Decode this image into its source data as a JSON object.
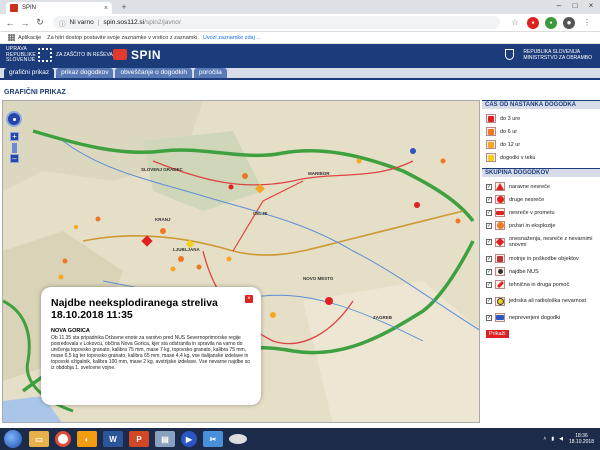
{
  "browser": {
    "tab_title": "SPIN",
    "url_info": "Ni varno",
    "url_host": "spin.sos112.si",
    "url_path": "/spin2/javno/",
    "bookmarks_label": "Aplikacije",
    "bookmarks_hint": "Za hitri dostop postavite svoje zaznamke v vrstico z zaznamki.",
    "bookmarks_link": "Uvozi zaznamke zdaj ..."
  },
  "site": {
    "org_line1": "UPRAVA",
    "org_line2": "REPUBLIKE",
    "org_line3": "SLOVENIJE",
    "org_line4": "ZA ZAŠČITO IN REŠEVANJE",
    "brand": "SPIN",
    "ministry_line1": "REPUBLIKA SLOVENIJA",
    "ministry_line2": "MINISTRSTVO ZA OBRAMBO"
  },
  "nav": {
    "tabs": [
      "grafični prikaz",
      "prikaz dogodkov",
      "obveščanje o dogodkih",
      "poročila"
    ]
  },
  "page": {
    "title": "GRAFIČNI PRIKAZ"
  },
  "map": {
    "places": [
      "MARIBOR",
      "SLOVENJ GRADEC",
      "CELJE",
      "KRANJ",
      "LJUBLJANA",
      "NOVO MESTO",
      "ZAGREB"
    ]
  },
  "popup": {
    "title_line1": "Najdbe neeksplodiranega streliva",
    "title_line2": "18.10.2018 11:35",
    "place": "NOVA GORICA",
    "body": "Ob 11.35 sta pripadnika Državne enote za varstvo pred NUS Severnoprimorske regije posredovala v Lokovcu, občina Nova Gorica, kjer sta odstranila in spravila na varno do uničenja topovsko granato, kalibra 75 mm, mase 7 kg, topovsko granato, kalibra 75 mm, mase 6,5 kg ter topovsko granato, kalibra 65 mm, mase 4,4 kg, vse italijanske izdelave in topovski vžigalnik, kalibra 100 mm, mase 2 kg, avstrijske izdelave. Vse nevarne najdbe so iz obdobja 1. svetovne vojne."
  },
  "panel": {
    "time_heading": "ČAS OD NASTANKA DOGODKA",
    "time_items": [
      {
        "label": "do 3 ure",
        "color": "#e02020"
      },
      {
        "label": "do 6 ur",
        "color": "#f07820"
      },
      {
        "label": "do 12 ur",
        "color": "#f5a623"
      },
      {
        "label": "dogodki v teku",
        "color": "#f0d020"
      }
    ],
    "group_heading": "SKUPINA DOGODKOV",
    "group_items": [
      {
        "label": "naravne nesreče",
        "icon": "triangle-icon"
      },
      {
        "label": "druge nesreče",
        "icon": "circle-icon"
      },
      {
        "label": "nesreče v prometu",
        "icon": "car-icon"
      },
      {
        "label": "požari in eksplozije",
        "icon": "fire-icon"
      },
      {
        "label": "onesnaženja, nesreče z nevarnimi snovmi",
        "icon": "diamond-icon"
      },
      {
        "label": "motnje in poškodbe objektov",
        "icon": "building-icon"
      },
      {
        "label": "najdbe NUS",
        "icon": "bomb-icon"
      },
      {
        "label": "tehnična in druga pomoč",
        "icon": "wrench-icon"
      },
      {
        "label": "jedrska ali radiološka nevarnost",
        "icon": "radiation-icon"
      },
      {
        "label": "nepreverjeni dogodki",
        "icon": "unknown-icon"
      }
    ],
    "show_button": "Prikaži"
  },
  "taskbar": {
    "time": "18:36",
    "date": "18.10.2018"
  },
  "colors": {
    "header_blue": "#1b3b7a",
    "tab_blue": "#5a7ab5",
    "alert_red": "#d22222"
  }
}
